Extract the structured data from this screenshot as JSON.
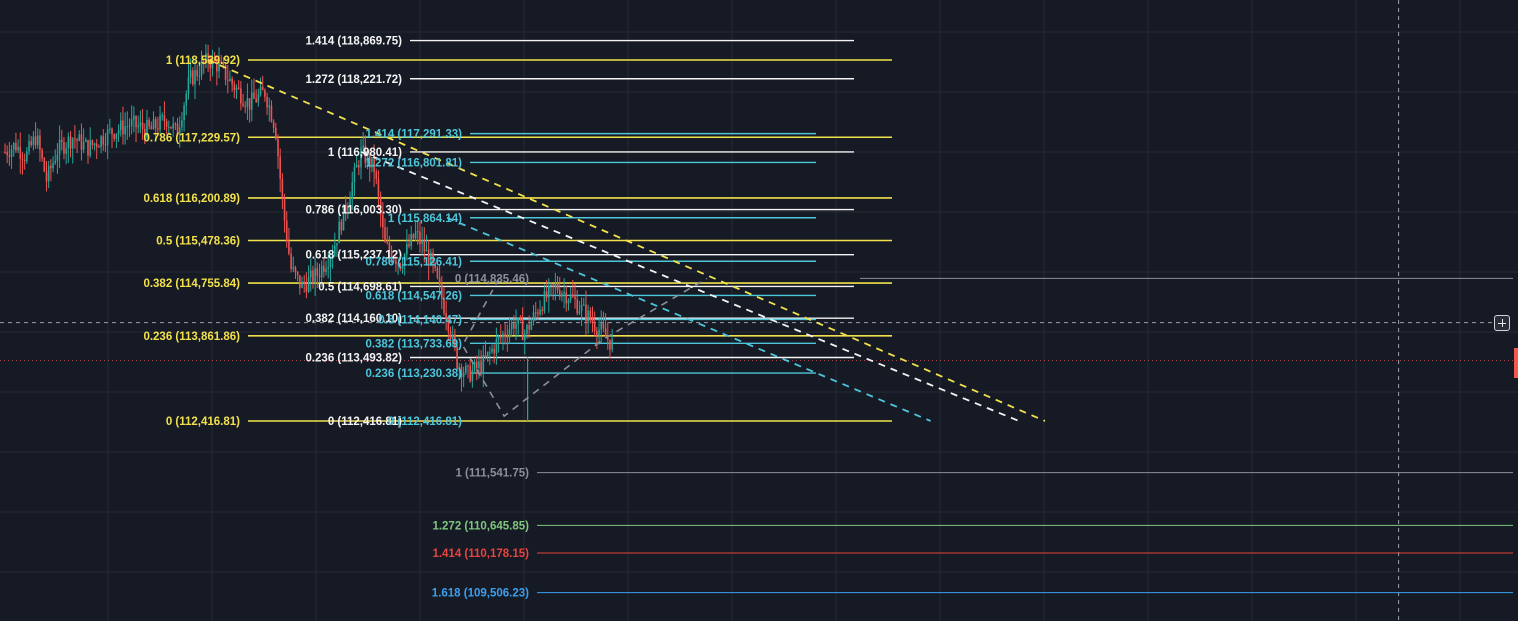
{
  "colors": {
    "background": "#161a25",
    "grid": "#242935",
    "candle_up": "#26a69a",
    "candle_down": "#ef5350",
    "yellow": "#f2e14c",
    "white": "#f4f4f4",
    "cyan": "#4dc6d9",
    "gray": "#8a8f98",
    "green": "#7fc77f",
    "red": "#e8433f",
    "blue": "#3aa0f0",
    "price_marker": "#f05b4f"
  },
  "ui": {
    "crosshair_button_icon": "plus-in-circle-icon"
  },
  "chart_data": {
    "type": "candlestick-with-fibonacci-overlays",
    "y_axis_scale": "linear price",
    "price_path": [
      [
        0,
        116980
      ],
      [
        0.02,
        117100
      ],
      [
        0.04,
        116900
      ],
      [
        0.06,
        117250
      ],
      [
        0.08,
        116500
      ],
      [
        0.1,
        117000
      ],
      [
        0.13,
        117229
      ],
      [
        0.16,
        117050
      ],
      [
        0.2,
        117300
      ],
      [
        0.24,
        117450
      ],
      [
        0.28,
        117350
      ],
      [
        0.31,
        117550
      ],
      [
        0.33,
        117300
      ],
      [
        0.355,
        118200
      ],
      [
        0.39,
        118539
      ],
      [
        0.41,
        118450
      ],
      [
        0.44,
        118100
      ],
      [
        0.47,
        117800
      ],
      [
        0.5,
        118000
      ],
      [
        0.52,
        117400
      ],
      [
        0.535,
        116000
      ],
      [
        0.55,
        115000
      ],
      [
        0.57,
        114700
      ],
      [
        0.6,
        114900
      ],
      [
        0.63,
        115300
      ],
      [
        0.66,
        116200
      ],
      [
        0.685,
        116980
      ],
      [
        0.71,
        116700
      ],
      [
        0.73,
        115400
      ],
      [
        0.76,
        115100
      ],
      [
        0.79,
        115600
      ],
      [
        0.82,
        115100
      ],
      [
        0.85,
        114200
      ],
      [
        0.87,
        113400
      ],
      [
        0.89,
        113200
      ],
      [
        0.92,
        113400
      ],
      [
        0.95,
        113800
      ],
      [
        0.98,
        114100
      ],
      [
        1.0,
        113900
      ],
      [
        1.03,
        114400
      ],
      [
        1.06,
        114700
      ],
      [
        1.09,
        114500
      ],
      [
        1.12,
        114200
      ],
      [
        1.15,
        113900
      ],
      [
        1.17,
        113700
      ]
    ],
    "wick_low": {
      "x": 1.005,
      "price": 112416.81
    },
    "fib_sets": [
      {
        "color_key": "yellow",
        "levels": [
          {
            "label": "1 (118,539.92)",
            "ratio": 1,
            "price": 118539.92
          },
          {
            "label": "0.786 (117,229.57)",
            "ratio": 0.786,
            "price": 117229.57
          },
          {
            "label": "0.618 (116,200.89)",
            "ratio": 0.618,
            "price": 116200.89
          },
          {
            "label": "0.5 (115,478.36)",
            "ratio": 0.5,
            "price": 115478.36
          },
          {
            "label": "0.382 (114,755.84)",
            "ratio": 0.382,
            "price": 114755.84
          },
          {
            "label": "0.236 (113,861.86)",
            "ratio": 0.236,
            "price": 113861.86
          },
          {
            "label": "0 (112,416.81)",
            "ratio": 0,
            "price": 112416.81
          }
        ]
      },
      {
        "color_key": "white",
        "levels": [
          {
            "label": "1.414 (118,869.75)",
            "ratio": 1.414,
            "price": 118869.75
          },
          {
            "label": "1.272 (118,221.72)",
            "ratio": 1.272,
            "price": 118221.72
          },
          {
            "label": "1 (116,980.41)",
            "ratio": 1,
            "price": 116980.41
          },
          {
            "label": "0.786 (116,003.30)",
            "ratio": 0.786,
            "price": 116003.3
          },
          {
            "label": "0.618 (115,237.12)",
            "ratio": 0.618,
            "price": 115237.12
          },
          {
            "label": "0.5 (114,698.61)",
            "ratio": 0.5,
            "price": 114698.61
          },
          {
            "label": "0.382 (114,160.10)",
            "ratio": 0.382,
            "price": 114160.1
          },
          {
            "label": "0.236 (113,493.82)",
            "ratio": 0.236,
            "price": 113493.82
          },
          {
            "label": "0 (112,416.81)",
            "ratio": 0,
            "price": 112416.81
          }
        ]
      },
      {
        "color_key": "cyan",
        "levels": [
          {
            "label": "1.414 (117,291.33)",
            "ratio": 1.414,
            "price": 117291.33
          },
          {
            "label": "1.272 (116,801.81)",
            "ratio": 1.272,
            "price": 116801.81
          },
          {
            "label": "1 (115,864.14)",
            "ratio": 1,
            "price": 115864.14
          },
          {
            "label": "0.786 (115,126.41)",
            "ratio": 0.786,
            "price": 115126.41
          },
          {
            "label": "0.618 (114,547.26)",
            "ratio": 0.618,
            "price": 114547.26
          },
          {
            "label": "0.5 (114,140.47)",
            "ratio": 0.5,
            "price": 114140.47
          },
          {
            "label": "0.382 (113,733.69)",
            "ratio": 0.382,
            "price": 113733.69
          },
          {
            "label": "0.236 (113,230.38)",
            "ratio": 0.236,
            "price": 113230.38
          },
          {
            "label": "0 (112,416.81)",
            "ratio": 0,
            "price": 112416.81
          }
        ]
      },
      {
        "color_key": "gray",
        "levels": [
          {
            "label": "0 (114,835.46)",
            "ratio": 0,
            "price": 114835.46
          },
          {
            "label": "1 (111,541.75)",
            "ratio": 1,
            "price": 111541.75
          }
        ]
      },
      {
        "color_key": "green",
        "levels": [
          {
            "label": "1.272 (110,645.85)",
            "ratio": 1.272,
            "price": 110645.85
          }
        ]
      },
      {
        "color_key": "red",
        "levels": [
          {
            "label": "1.414 (110,178.15)",
            "ratio": 1.414,
            "price": 110178.15
          }
        ]
      },
      {
        "color_key": "blue",
        "levels": [
          {
            "label": "1.618 (109,506.23)",
            "ratio": 1.618,
            "price": 109506.23
          }
        ]
      }
    ],
    "trend_lines": [
      {
        "color_key": "yellow",
        "from": [
          0.39,
          118539.92
        ],
        "to": [
          2.0,
          112416.81
        ],
        "style": "dashed"
      },
      {
        "color_key": "white",
        "from": [
          0.685,
          116980.41
        ],
        "to": [
          1.95,
          112416.81
        ],
        "style": "dashed"
      },
      {
        "color_key": "cyan",
        "from": [
          0.85,
          115864.14
        ],
        "to": [
          1.78,
          112416.81
        ],
        "style": "dashed"
      },
      {
        "color_key": "gray",
        "path": [
          [
            0.95,
            114835.46
          ],
          [
            0.88,
            113700
          ],
          [
            0.96,
            112500
          ],
          [
            1.15,
            113800
          ],
          [
            1.35,
            114835.46
          ]
        ],
        "style": "dashed"
      }
    ],
    "crosshair": {
      "x": 2.68,
      "price": 114085.0
    },
    "last_price": 113493.82
  }
}
